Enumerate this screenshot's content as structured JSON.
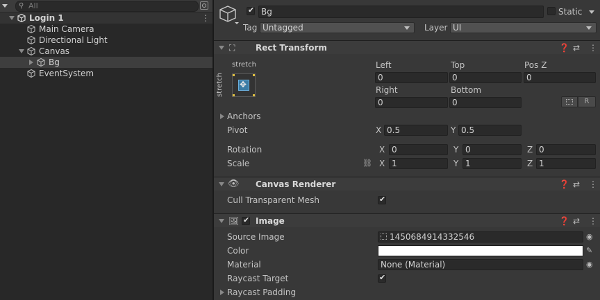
{
  "hierarchy": {
    "search_placeholder": "All",
    "items": [
      {
        "label": "Login 1"
      },
      {
        "label": "Main Camera"
      },
      {
        "label": "Directional Light"
      },
      {
        "label": "Canvas"
      },
      {
        "label": "Bg"
      },
      {
        "label": "EventSystem"
      }
    ]
  },
  "inspector": {
    "object_name": "Bg",
    "static_label": "Static",
    "tag_label": "Tag",
    "tag_value": "Untagged",
    "layer_label": "Layer",
    "layer_value": "UI",
    "rect_transform": {
      "title": "Rect Transform",
      "anchor_top": "stretch",
      "anchor_side": "stretch",
      "left_label": "Left",
      "left_value": "0",
      "top_label": "Top",
      "top_value": "0",
      "posz_label": "Pos Z",
      "posz_value": "0",
      "right_label": "Right",
      "right_value": "0",
      "bottom_label": "Bottom",
      "bottom_value": "0",
      "r_button": "R",
      "anchors_label": "Anchors",
      "pivot_label": "Pivot",
      "pivot_x": "0.5",
      "pivot_y": "0.5",
      "rotation_label": "Rotation",
      "rot_x": "0",
      "rot_y": "0",
      "rot_z": "0",
      "scale_label": "Scale",
      "scale_x": "1",
      "scale_y": "1",
      "scale_z": "1",
      "x": "X",
      "y": "Y",
      "z": "Z"
    },
    "canvas_renderer": {
      "title": "Canvas Renderer",
      "cull_label": "Cull Transparent Mesh"
    },
    "image": {
      "title": "Image",
      "source_label": "Source Image",
      "source_value": "1450684914332546",
      "color_label": "Color",
      "material_label": "Material",
      "material_value": "None (Material)",
      "raycast_target_label": "Raycast Target",
      "raycast_padding_label": "Raycast Padding"
    }
  }
}
